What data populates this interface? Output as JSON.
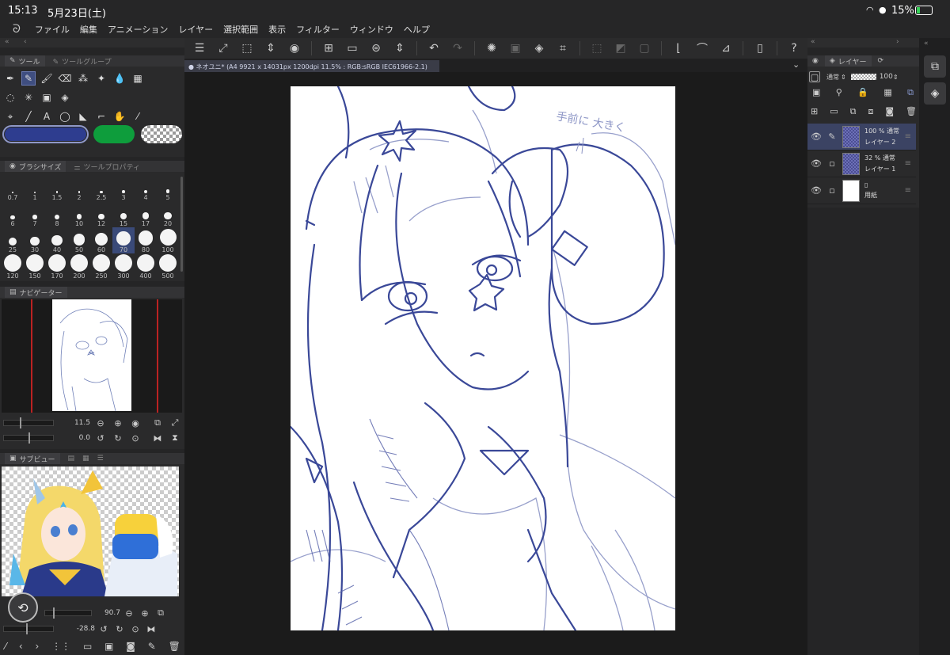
{
  "status": {
    "time": "15:13",
    "date": "5月23日(土)",
    "battery": "15%"
  },
  "menu": [
    "ファイル",
    "編集",
    "アニメーション",
    "レイヤー",
    "選択範囲",
    "表示",
    "フィルター",
    "ウィンドウ",
    "ヘルプ"
  ],
  "tools_panel": {
    "tab1": "ツール",
    "tab2": "ツールグループ"
  },
  "brush_panel": {
    "tab1": "ブラシサイズ",
    "tab2": "ツールプロパティ",
    "sizes": [
      "0.7",
      "1",
      "1.5",
      "2",
      "2.5",
      "3",
      "4",
      "5",
      "6",
      "7",
      "8",
      "10",
      "12",
      "15",
      "17",
      "20",
      "25",
      "30",
      "40",
      "50",
      "60",
      "70",
      "80",
      "100",
      "120",
      "150",
      "170",
      "200",
      "250",
      "300",
      "400",
      "500"
    ],
    "selected": "70"
  },
  "navigator": {
    "title": "ナビゲーター",
    "zoom": "11.5",
    "rotation": "0.0"
  },
  "subview": {
    "title": "サブビュー",
    "zoom": "90.7",
    "rotation": "-28.8"
  },
  "canvas_tab": {
    "title": "● ネオユニ* (A4 9921 x 14031px 1200dpi 11.5% : RGB:sRGB IEC61966-2.1)"
  },
  "sketch_note": "手前に 大きく",
  "layers_panel": {
    "title": "レイヤー",
    "blend_mode": "通常",
    "opacity": "100",
    "layers": [
      {
        "info": "100 % 通常",
        "name": "レイヤー 2"
      },
      {
        "info": "32 % 通常",
        "name": "レイヤー 1"
      },
      {
        "info": "",
        "name": "用紙"
      }
    ]
  },
  "colors": {
    "main": "#2e3d8f",
    "sub": "#0e9d3c",
    "accent_selected": "#3a4a78",
    "sketch": "#3c4aa0"
  }
}
